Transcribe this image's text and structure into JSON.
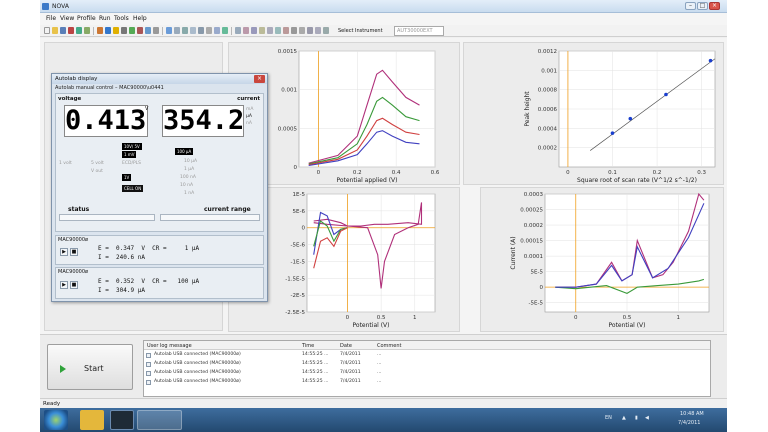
{
  "app": {
    "title": "NOVA"
  },
  "menu": [
    "File",
    "View",
    "Profile",
    "Run",
    "Tools",
    "Help"
  ],
  "toolbar": {
    "instrument_label": "Select Instrument",
    "instrument_value": "AUT30000EXT"
  },
  "dialog": {
    "title": "Autolab display",
    "section_title": "Autolab manual control – MAC90000\\u0441",
    "voltage_label": "voltage",
    "current_label": "current",
    "voltage_value": "0.413",
    "voltage_unit": "V",
    "current_value": "354.2",
    "current_units": [
      "mA",
      "µA",
      "nA"
    ],
    "voltage_btns": [
      "10V/ 5V",
      "1 mV",
      "1V"
    ],
    "voltage_grey": [
      "1 volt",
      "5 volt",
      "ECD/PLS",
      "V out"
    ],
    "current_btn": "100 µA",
    "current_grey": [
      "10 µA",
      "1 µA",
      "100 nA",
      "10 nA",
      "1 nA"
    ],
    "status_label": "status",
    "current_range_label": "current range",
    "instrument1": "MAC90000ø",
    "instrument1_line1": "E =  0.347  V  CR =     1 µA",
    "instrument1_line2": "I =  240.6 nA",
    "instrument2": "MAC90000ø",
    "instrument2_line1": "E =  0.352  V  CR =   100 µA",
    "instrument2_line2": "I =  304.9 µA"
  },
  "chart_data": [
    {
      "type": "line",
      "title": "",
      "xlabel": "Potential applied (V)",
      "ylabel": "",
      "xlim": [
        -0.1,
        0.6
      ],
      "ylim": [
        0,
        0.0015
      ],
      "xticks": [
        "0",
        "0.2",
        "0.4",
        "0.6"
      ],
      "yticks": [
        "0.0015",
        "0.001",
        "0.0005",
        "0"
      ],
      "series": [
        {
          "color": "#b0307a",
          "x": [
            -0.05,
            0.1,
            0.2,
            0.25,
            0.3,
            0.33,
            0.38,
            0.45,
            0.52
          ],
          "y": [
            5e-05,
            0.00015,
            0.0004,
            0.0008,
            0.0012,
            0.00125,
            0.0011,
            0.0009,
            0.0008
          ]
        },
        {
          "color": "#3a9a3a",
          "x": [
            -0.05,
            0.1,
            0.2,
            0.25,
            0.3,
            0.33,
            0.38,
            0.45,
            0.52
          ],
          "y": [
            4e-05,
            0.00012,
            0.0003,
            0.00055,
            0.00085,
            0.0009,
            0.0008,
            0.00065,
            0.0006
          ]
        },
        {
          "color": "#d04040",
          "x": [
            -0.05,
            0.1,
            0.2,
            0.25,
            0.3,
            0.33,
            0.38,
            0.45,
            0.52
          ],
          "y": [
            3e-05,
            0.0001,
            0.00022,
            0.0004,
            0.0006,
            0.00063,
            0.00055,
            0.00045,
            0.00042
          ]
        },
        {
          "color": "#4040c0",
          "x": [
            -0.05,
            0.1,
            0.2,
            0.25,
            0.3,
            0.33,
            0.38,
            0.45,
            0.52
          ],
          "y": [
            2e-05,
            8e-05,
            0.00016,
            0.0003,
            0.00045,
            0.00047,
            0.0004,
            0.00032,
            0.0003
          ]
        }
      ]
    },
    {
      "type": "scatter",
      "title": "",
      "xlabel": "Square root of scan rate (V^1/2 s^-1/2)",
      "ylabel": "Peak height",
      "xlim": [
        -0.02,
        0.33
      ],
      "ylim": [
        0,
        0.0012
      ],
      "xticks": [
        "0",
        "0.1",
        "0.2",
        "0.3"
      ],
      "yticks": [
        "0.0012",
        "0.001",
        "0.0008",
        "0.0006",
        "0.0004",
        "0.0002"
      ],
      "points": {
        "x": [
          0.1,
          0.14,
          0.22,
          0.32
        ],
        "y": [
          0.00035,
          0.0005,
          0.00075,
          0.0011
        ]
      },
      "fit_line": {
        "x": [
          0.05,
          0.33
        ],
        "y": [
          0.00017,
          0.00112
        ]
      }
    },
    {
      "type": "line",
      "title": "",
      "xlabel": "Potential (V)",
      "ylabel": "",
      "xlim": [
        -0.6,
        1.3
      ],
      "ylim": [
        -2.5e-05,
        1e-05
      ],
      "xticks": [
        "0",
        "0.5",
        "1"
      ],
      "yticks": [
        "1E-5",
        "5E-6",
        "0",
        "-5E-6",
        "-1E-5",
        "-1.5E-5",
        "-2E-5",
        "-2.5E-5"
      ],
      "series": [
        {
          "color": "#b0307a",
          "x": [
            -0.5,
            -0.3,
            -0.1,
            0,
            0.3,
            0.45,
            0.5,
            0.55,
            0.7,
            0.9,
            1.05,
            1.1,
            1.1,
            0.9,
            0.6,
            0.4,
            0.2,
            0,
            -0.3,
            -0.5
          ],
          "y": [
            2e-06,
            2.5e-06,
            1.5e-06,
            5e-07,
            0,
            -8e-06,
            -1.8e-05,
            -1e-05,
            -2e-06,
            0,
            1e-06,
            7.5e-06,
            1e-06,
            1.5e-06,
            1e-06,
            1e-06,
            5e-07,
            5e-07,
            1e-06,
            1.5e-06
          ]
        },
        {
          "color": "#4040c0",
          "x": [
            -0.5,
            -0.4,
            -0.3,
            -0.2,
            -0.1,
            0
          ],
          "y": [
            -8e-06,
            4.5e-06,
            3.5e-06,
            -2e-06,
            -5e-07,
            0
          ]
        },
        {
          "color": "#3a9a3a",
          "x": [
            -0.5,
            -0.4,
            -0.3,
            -0.2,
            -0.1,
            0
          ],
          "y": [
            -5.5e-06,
            2e-06,
            5e-07,
            -4e-06,
            -5e-07,
            0
          ]
        },
        {
          "color": "#d04040",
          "x": [
            -0.5,
            -0.4,
            -0.3,
            -0.2,
            -0.1,
            0
          ],
          "y": [
            -1.2e-05,
            -4e-06,
            -3e-06,
            -5.5e-06,
            -1e-06,
            0
          ]
        }
      ]
    },
    {
      "type": "line",
      "title": "",
      "xlabel": "Potential (V)",
      "ylabel": "Current (A)",
      "xlim": [
        -0.3,
        1.3
      ],
      "ylim": [
        -8e-05,
        0.0003
      ],
      "xticks": [
        "0",
        "0.5",
        "1"
      ],
      "yticks": [
        "0.0003",
        "0.00025",
        "0.0002",
        "0.00015",
        "0.0001",
        "5E-5",
        "0",
        "-5E-5"
      ],
      "series": [
        {
          "color": "#b0307a",
          "x": [
            -0.2,
            0,
            0.2,
            0.35,
            0.45,
            0.55,
            0.6,
            0.75,
            0.85,
            0.95,
            1.1,
            1.2,
            1.25
          ],
          "y": [
            0,
            0,
            1e-05,
            8e-05,
            2e-05,
            4e-05,
            0.00015,
            3e-05,
            4e-05,
            8e-05,
            0.00018,
            0.0003,
            0.00028
          ]
        },
        {
          "color": "#3a9a3a",
          "x": [
            -0.2,
            0,
            0.3,
            0.5,
            0.6,
            0.8,
            1.0,
            1.2,
            1.25
          ],
          "y": [
            0,
            -5e-06,
            5e-06,
            -2e-05,
            0,
            5e-06,
            1e-05,
            2e-05,
            2.5e-05
          ]
        },
        {
          "color": "#4040c0",
          "x": [
            -0.2,
            0,
            0.2,
            0.35,
            0.45,
            0.55,
            0.6,
            0.75,
            0.9,
            1.1,
            1.25
          ],
          "y": [
            0,
            0,
            1e-05,
            7e-05,
            2e-05,
            4e-05,
            0.00013,
            3e-05,
            6e-05,
            0.00016,
            0.00027
          ]
        }
      ]
    }
  ],
  "start_button": "Start",
  "log": {
    "headers": [
      "User log message",
      "Time",
      "Date",
      "Comment"
    ],
    "rows": [
      {
        "msg": "Autolab USB connected (MAC90000ø)",
        "time": "14:55:25 ...",
        "date": "7/4/2011",
        "comment": "..."
      },
      {
        "msg": "Autolab USB connected (MAC90000ø)",
        "time": "14:55:25 ...",
        "date": "7/4/2011",
        "comment": "..."
      },
      {
        "msg": "Autolab USB connected (MAC90000ø)",
        "time": "14:55:25 ...",
        "date": "7/4/2011",
        "comment": "..."
      },
      {
        "msg": "Autolab USB connected (MAC90000ø)",
        "time": "14:55:25 ...",
        "date": "7/4/2011",
        "comment": "..."
      }
    ]
  },
  "status": "Ready",
  "taskbar": {
    "lang": "EN",
    "time": "10:48 AM",
    "date": "7/4/2011"
  }
}
